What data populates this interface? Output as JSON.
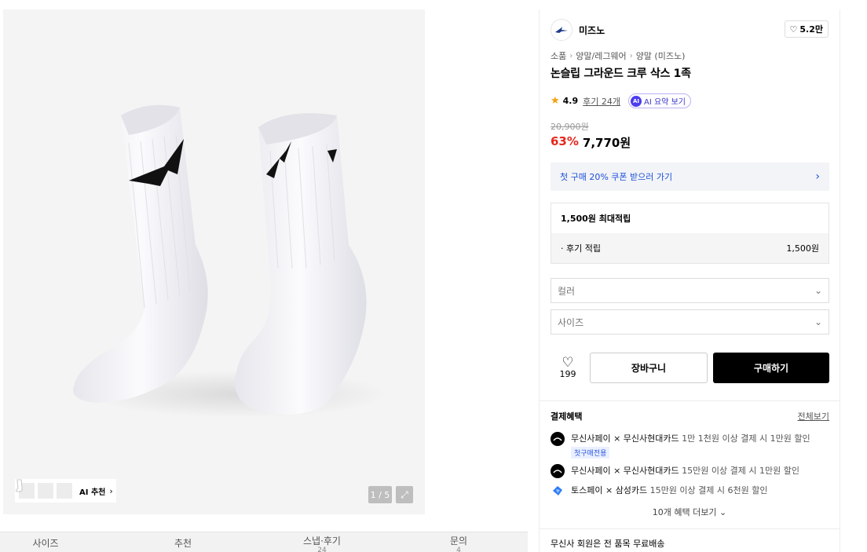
{
  "gallery": {
    "pager": "1 / 5",
    "ai_recommend_label": "AI 추천",
    "thumbnail_count": 3
  },
  "tabs": [
    {
      "label": "사이즈",
      "count": ""
    },
    {
      "label": "추천",
      "count": ""
    },
    {
      "label": "스냅·후기",
      "count": "24"
    },
    {
      "label": "문의",
      "count": "4"
    }
  ],
  "brand": {
    "name": "미즈노",
    "like_count": "5.2만"
  },
  "breadcrumb": [
    "소품",
    "양말/레그웨어",
    "양말 (미즈노)"
  ],
  "product": {
    "title": "논슬립 그라운드 크루 삭스 1족",
    "rating": "4.9",
    "review_link": "후기 24개",
    "ai_summary_label": "AI 요약 보기",
    "original_price": "20,900원",
    "discount": "63%",
    "sale_price": "7,770원"
  },
  "coupon": {
    "label": "첫 구매 20% 쿠폰 받으러 가기"
  },
  "points": {
    "header": "1,500원 최대적립",
    "row_label": "· 후기 적립",
    "row_value": "1,500원"
  },
  "options": {
    "color_placeholder": "컬러",
    "size_placeholder": "사이즈"
  },
  "actions": {
    "wish_count": "199",
    "cart_label": "장바구니",
    "buy_label": "구매하기"
  },
  "payment_benefits": {
    "title": "결제혜택",
    "see_all": "전체보기",
    "items": [
      {
        "brand": "무신사페이 × 무신사현대카드",
        "detail": " 1만 1천원 이상 결제 시 1만원 할인",
        "tag": "첫구매전용",
        "icon": "musinsa-pay-icon"
      },
      {
        "brand": "무신사페이 × 무신사현대카드",
        "detail": " 15만원 이상 결제 시 1만원 할인",
        "tag": "",
        "icon": "musinsa-pay-icon"
      },
      {
        "brand": "토스페이 × 삼성카드",
        "detail": " 15만원 이상 결제 시 6천원 할인",
        "tag": "",
        "icon": "toss-pay-icon"
      }
    ],
    "more": "10개 혜택 더보기"
  },
  "shipping": {
    "label": "무신사 회원은 전 품목 무료배송"
  },
  "colors": {
    "discount_red": "#e6271c",
    "coupon_blue": "#1e4fd8",
    "ai_purple": "#4b3cf0",
    "star_orange": "#f59e0b"
  }
}
